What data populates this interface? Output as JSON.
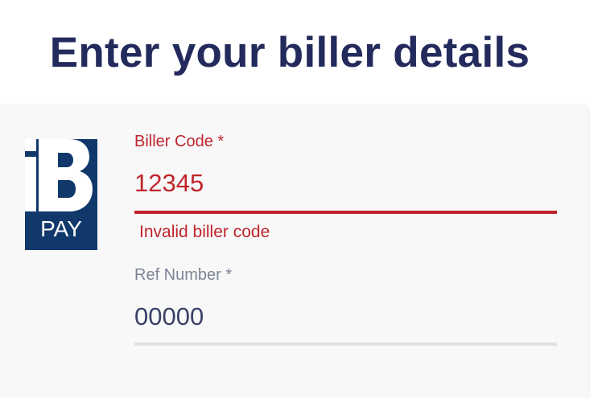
{
  "page": {
    "title": "Enter your biller details"
  },
  "logo": {
    "alt": "BPAY",
    "text": "PAY"
  },
  "form": {
    "biller_code": {
      "label": "Biller Code *",
      "value": "12345",
      "error": "Invalid biller code"
    },
    "ref_number": {
      "label": "Ref Number *",
      "value": "00000"
    }
  },
  "colors": {
    "title": "#232a5c",
    "error": "#c0242b",
    "logo_bg": "#11386b",
    "label_muted": "#7d8594",
    "input_text": "#3a4266",
    "underline_default": "#e0e2e8",
    "card_bg": "#f8f8f9"
  }
}
